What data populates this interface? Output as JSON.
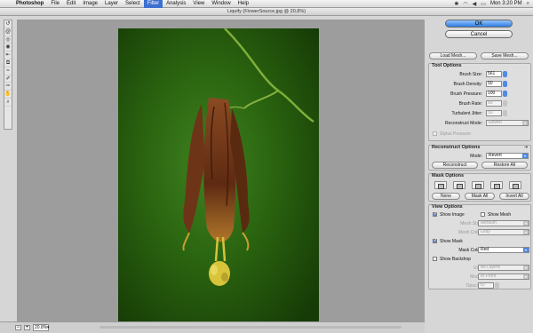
{
  "menubar": {
    "app": "Photoshop",
    "items": [
      "File",
      "Edit",
      "Image",
      "Layer",
      "Select",
      "Filter",
      "Analysis",
      "View",
      "Window",
      "Help"
    ],
    "active": "Filter",
    "clock": "Mon 3:20 PM"
  },
  "window": {
    "title": "Liquify (FlowerSource.jpg @ 20.8%)"
  },
  "status": {
    "zoom": "20.8%",
    "zoom_out": "−",
    "zoom_in": "+"
  },
  "panel": {
    "ok": "OK",
    "cancel": "Cancel",
    "load_mesh": "Load Mesh...",
    "save_mesh": "Save Mesh...",
    "tool_options": {
      "title": "Tool Options",
      "brush_size": {
        "label": "Brush Size:",
        "value": "561"
      },
      "brush_density": {
        "label": "Brush Density:",
        "value": "50"
      },
      "brush_pressure": {
        "label": "Brush Pressure:",
        "value": "100"
      },
      "brush_rate": {
        "label": "Brush Rate:",
        "value": "80"
      },
      "turbulent_jitter": {
        "label": "Turbulent Jitter:",
        "value": "50"
      },
      "reconstruct_mode": {
        "label": "Reconstruct Mode:",
        "value": "Revert"
      },
      "stylus_pressure": "Stylus Pressure"
    },
    "reconstruct_options": {
      "title": "Reconstruct Options",
      "mode_label": "Mode:",
      "mode_value": "Revert",
      "reconstruct": "Reconstruct",
      "restore_all": "Restore All"
    },
    "mask_options": {
      "title": "Mask Options",
      "none": "None",
      "mask_all": "Mask All",
      "invert_all": "Invert All"
    },
    "view_options": {
      "title": "View Options",
      "show_image": "Show Image",
      "show_mesh": "Show Mesh",
      "mesh_size": {
        "label": "Mesh Size:",
        "value": "Medium"
      },
      "mesh_color": {
        "label": "Mesh Color:",
        "value": "Gray"
      },
      "show_mask": "Show Mask",
      "mask_color": {
        "label": "Mask Color:",
        "value": "Red"
      },
      "show_backdrop": "Show Backdrop",
      "use": {
        "label": "Use:",
        "value": "All Layers"
      },
      "mode": {
        "label": "Mode:",
        "value": "In Front"
      },
      "opacity": {
        "label": "Opacity:",
        "value": "50"
      }
    }
  }
}
